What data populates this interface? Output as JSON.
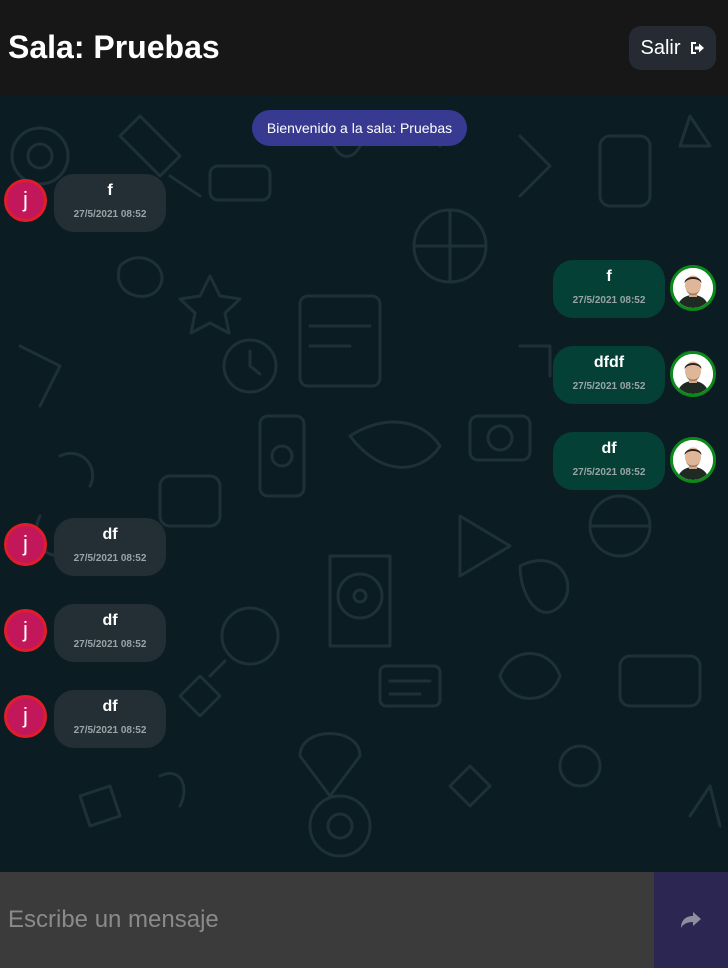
{
  "header": {
    "title": "Sala: Pruebas",
    "exit_label": "Salir",
    "exit_icon": "sign-out-icon"
  },
  "system_message": "Bienvenido a la sala: Pruebas",
  "messages": [
    {
      "sender": "other",
      "avatar_letter": "j",
      "text": "f",
      "time": "27/5/2021 08:52"
    },
    {
      "sender": "me",
      "text": "f",
      "time": "27/5/2021 08:52"
    },
    {
      "sender": "me",
      "text": "dfdf",
      "time": "27/5/2021 08:52"
    },
    {
      "sender": "me",
      "text": "df",
      "time": "27/5/2021 08:52"
    },
    {
      "sender": "other",
      "avatar_letter": "j",
      "text": "df",
      "time": "27/5/2021 08:52"
    },
    {
      "sender": "other",
      "avatar_letter": "j",
      "text": "df",
      "time": "27/5/2021 08:52"
    },
    {
      "sender": "other",
      "avatar_letter": "j",
      "text": "df",
      "time": "27/5/2021 08:52"
    }
  ],
  "composer": {
    "placeholder": "Escribe un mensaje",
    "send_icon": "send-arrow-icon"
  },
  "colors": {
    "header_bg": "#171717",
    "chat_bg": "#0c1c23",
    "system_bubble": "#383a92",
    "other_bubble": "#232e35",
    "my_bubble": "#054036",
    "other_avatar": "#c2185b",
    "send_button": "#2c2752"
  }
}
